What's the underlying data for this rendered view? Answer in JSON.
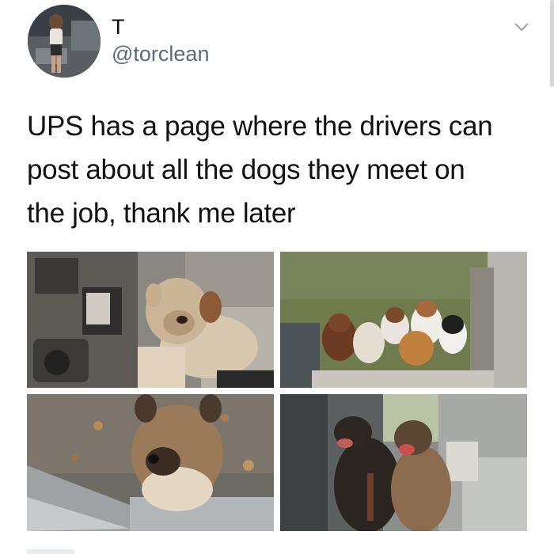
{
  "tweet": {
    "display_name": "T",
    "handle": "@torclean",
    "text_lines": [
      "UPS has a page where the drivers can",
      "post about all the dogs they meet on",
      "the job, thank me later"
    ],
    "icons": {
      "menu": "chevron-down-icon"
    }
  },
  "colors": {
    "text": "#111111",
    "handle": "#5b6b78",
    "chevron": "#9aa4ad"
  }
}
